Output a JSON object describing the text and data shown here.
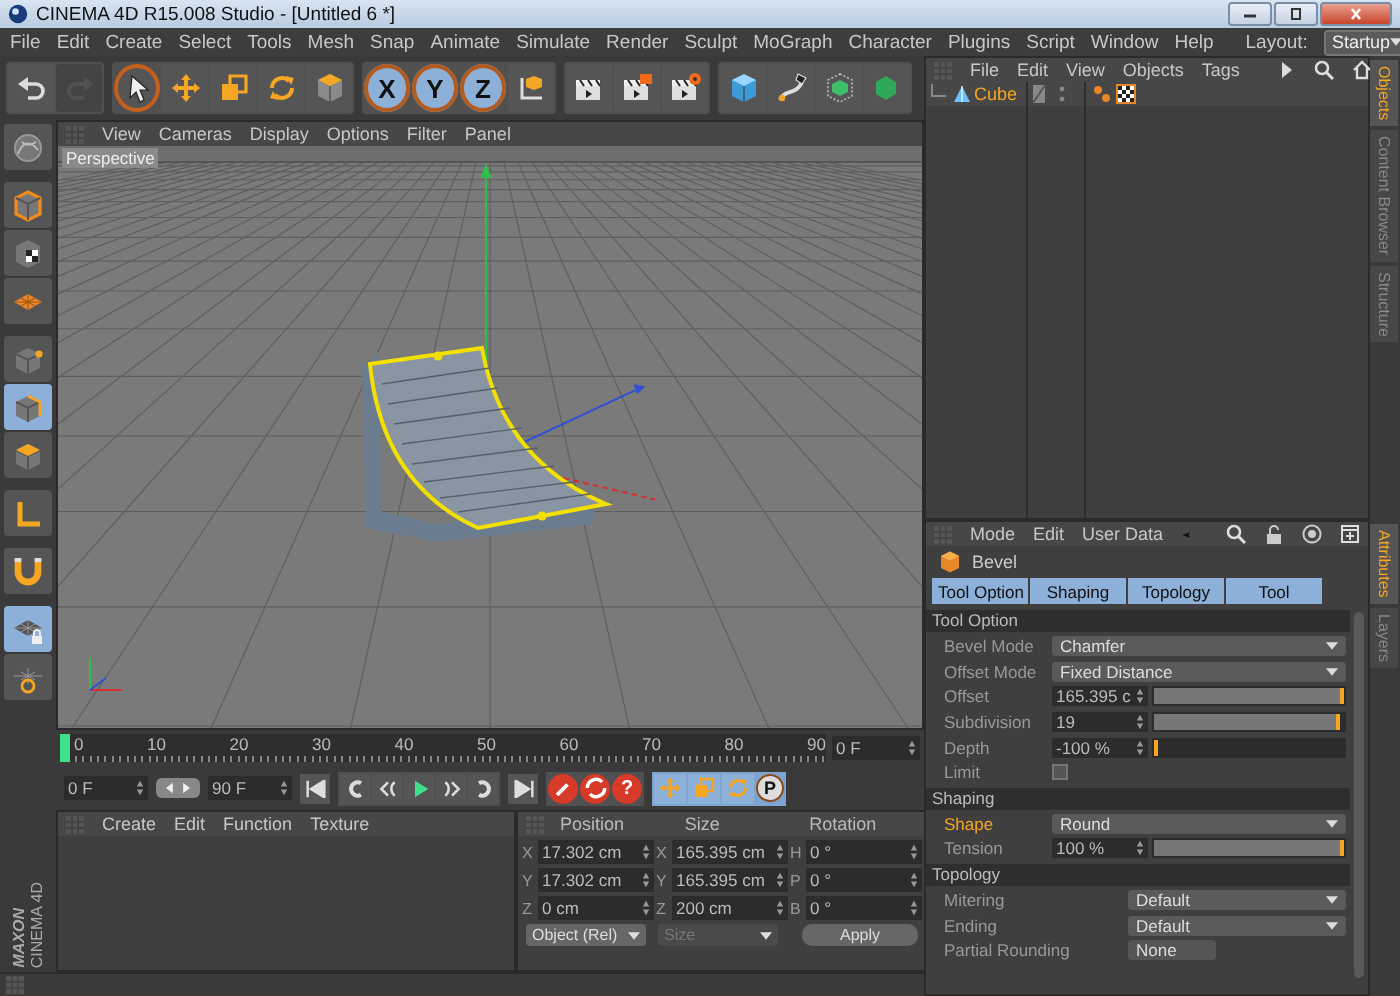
{
  "window": {
    "title": "CINEMA 4D R15.008 Studio - [Untitled 6 *]"
  },
  "menu_bar": [
    "File",
    "Edit",
    "Create",
    "Select",
    "Tools",
    "Mesh",
    "Snap",
    "Animate",
    "Simulate",
    "Render",
    "Sculpt",
    "MoGraph",
    "Character",
    "Plugins",
    "Script",
    "Window",
    "Help"
  ],
  "layout": {
    "label": "Layout:",
    "value": "Startup"
  },
  "toolbar": [
    {
      "items": [
        {
          "kind": "undo",
          "selected": false,
          "disabled": false
        },
        {
          "kind": "redo",
          "selected": false,
          "disabled": true
        }
      ]
    },
    {
      "items": [
        {
          "kind": "select",
          "selected": true,
          "disabled": false
        },
        {
          "kind": "move",
          "selected": false,
          "disabled": false
        },
        {
          "kind": "scale",
          "selected": false,
          "disabled": false
        },
        {
          "kind": "rotate",
          "selected": false,
          "disabled": false
        },
        {
          "kind": "object",
          "selected": false,
          "disabled": false
        }
      ]
    },
    {
      "items": [
        {
          "kind": "axis",
          "label": "X",
          "selected": true,
          "disabled": false
        },
        {
          "kind": "axis",
          "label": "Y",
          "selected": true,
          "disabled": false
        },
        {
          "kind": "axis",
          "label": "Z",
          "selected": true,
          "disabled": false
        },
        {
          "kind": "coords",
          "selected": false,
          "disabled": false
        }
      ]
    },
    {
      "items": [
        {
          "kind": "render-view",
          "selected": false,
          "disabled": false
        },
        {
          "kind": "render-picture",
          "selected": false,
          "disabled": false
        },
        {
          "kind": "render-settings",
          "selected": false,
          "disabled": false
        }
      ]
    },
    {
      "items": [
        {
          "kind": "cube",
          "selected": false,
          "disabled": false
        },
        {
          "kind": "pen",
          "selected": false,
          "disabled": false
        },
        {
          "kind": "subdivision",
          "selected": false,
          "disabled": false
        },
        {
          "kind": "gem",
          "selected": false,
          "disabled": false
        }
      ]
    }
  ],
  "left_toolbar": [
    {
      "items": [
        {
          "kind": "sculpt",
          "selected": false
        }
      ]
    },
    {
      "items": [
        {
          "kind": "model",
          "selected": false
        },
        {
          "kind": "texture",
          "selected": false
        },
        {
          "kind": "workplane",
          "selected": false
        }
      ]
    },
    {
      "items": [
        {
          "kind": "points",
          "selected": false
        },
        {
          "kind": "edges",
          "selected": true
        },
        {
          "kind": "polygons",
          "selected": false
        }
      ]
    },
    {
      "items": [
        {
          "kind": "axis-mode",
          "selected": false
        }
      ]
    },
    {
      "items": [
        {
          "kind": "snap",
          "selected": false
        }
      ]
    },
    {
      "items": [
        {
          "kind": "lock",
          "selected": true
        },
        {
          "kind": "grid",
          "selected": false
        }
      ]
    }
  ],
  "viewport": {
    "menu": [
      "View",
      "Cameras",
      "Display",
      "Options",
      "Filter",
      "Panel"
    ],
    "camera": "Perspective"
  },
  "timeline": {
    "ticks": [
      "0",
      "10",
      "20",
      "30",
      "40",
      "50",
      "60",
      "70",
      "80",
      "90"
    ],
    "level": 0,
    "current": "0 F"
  },
  "transport": {
    "start": "0 F",
    "end": "90 F",
    "key_buttons": [
      {
        "kind": "record"
      },
      {
        "kind": "autokey"
      },
      {
        "kind": "keyset",
        "symbol": "?"
      }
    ],
    "key_channels": [
      {
        "kind": "move"
      },
      {
        "kind": "scale"
      },
      {
        "kind": "rotate"
      },
      {
        "kind": "param",
        "label": "P"
      }
    ]
  },
  "materials": {
    "menu": [
      "Create",
      "Edit",
      "Function",
      "Texture"
    ]
  },
  "brand": {
    "maker": "MAXON",
    "product": "CINEMA 4D"
  },
  "coordinates": {
    "headers": [
      "Position",
      "Size",
      "Rotation"
    ],
    "rows": [
      [
        {
          "axis": "X",
          "value": "17.302 cm"
        },
        {
          "axis": "X",
          "value": "165.395 cm"
        },
        {
          "axis": "H",
          "value": "0 °"
        }
      ],
      [
        {
          "axis": "Y",
          "value": "17.302 cm"
        },
        {
          "axis": "Y",
          "value": "165.395 cm"
        },
        {
          "axis": "P",
          "value": "0 °"
        }
      ],
      [
        {
          "axis": "Z",
          "value": "0 cm"
        },
        {
          "axis": "Z",
          "value": "200 cm"
        },
        {
          "axis": "B",
          "value": "0 °"
        }
      ]
    ],
    "mode": "Object (Rel)",
    "size_mode": "Size",
    "apply": "Apply"
  },
  "objects": {
    "menu": [
      "File",
      "Edit",
      "View",
      "Objects",
      "Tags"
    ],
    "items": [
      {
        "name": "Cube",
        "selected": true
      }
    ]
  },
  "attributes": {
    "menu": [
      "Mode",
      "Edit",
      "User Data"
    ],
    "title": "Bevel",
    "tabs": [
      {
        "label": "Tool Option",
        "selected": true
      },
      {
        "label": "Shaping",
        "selected": true
      },
      {
        "label": "Topology",
        "selected": true
      },
      {
        "label": "Tool",
        "selected": true
      }
    ],
    "sections": [
      {
        "title": "Tool Option",
        "rows": [
          {
            "kind": "dropdown",
            "label": "Bevel Mode",
            "value": "Chamfer",
            "highlighted": false
          },
          {
            "kind": "dropdown",
            "label": "Offset Mode",
            "value": "Fixed Distance",
            "highlighted": false
          },
          {
            "kind": "slider",
            "label": "Offset",
            "value": "165.395 c",
            "level": 1,
            "highlighted": false
          },
          {
            "kind": "slider",
            "label": "Subdivision",
            "value": "19",
            "level": 0.98,
            "highlighted": false
          },
          {
            "kind": "slider",
            "label": "Depth",
            "value": "-100 %",
            "level": 0,
            "highlighted": false
          },
          {
            "kind": "checkbox",
            "label": "Limit",
            "checked": false,
            "highlighted": false
          }
        ]
      },
      {
        "title": "Shaping",
        "rows": [
          {
            "kind": "dropdown",
            "label": "Shape",
            "value": "Round",
            "highlighted": true
          },
          {
            "kind": "slider",
            "label": "Tension",
            "value": "100 %",
            "level": 1,
            "highlighted": false
          }
        ]
      },
      {
        "title": "Topology",
        "rows": [
          {
            "kind": "dropdown",
            "label": "Mitering",
            "value": "Default",
            "highlighted": false
          },
          {
            "kind": "dropdown",
            "label": "Ending",
            "value": "Default",
            "highlighted": false
          },
          {
            "kind": "button",
            "label": "Partial Rounding",
            "value": "None",
            "highlighted": false
          }
        ]
      }
    ]
  },
  "side_tabs_top": [
    {
      "label": "Objects",
      "selected": true
    },
    {
      "label": "Content Browser",
      "selected": false
    },
    {
      "label": "Structure",
      "selected": false
    }
  ],
  "side_tabs_bottom": [
    {
      "label": "Attributes",
      "selected": true
    },
    {
      "label": "Layers",
      "selected": false
    }
  ]
}
